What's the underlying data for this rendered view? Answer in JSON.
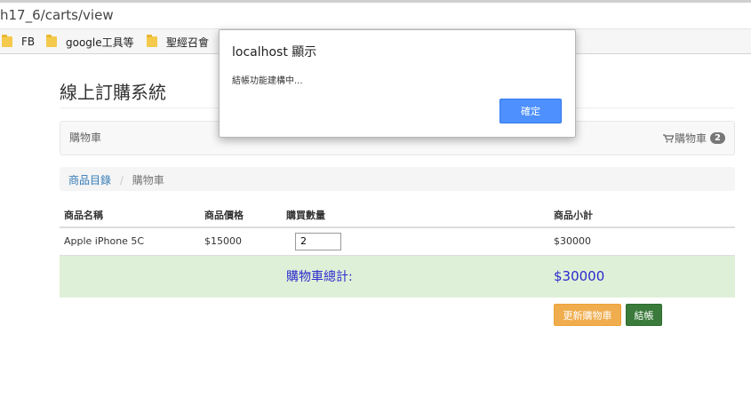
{
  "browser": {
    "url": "h17_6/carts/view",
    "bookmarks": [
      "FB",
      "google工具等",
      "聖經召會"
    ]
  },
  "app": {
    "title": "線上訂購系統"
  },
  "navbar": {
    "brand": "購物車",
    "cart_label": "購物車",
    "cart_count": "2"
  },
  "breadcrumb": {
    "link": "商品目錄",
    "separator": "/",
    "current": "購物車"
  },
  "table": {
    "headers": [
      "商品名稱",
      "商品價格",
      "購買數量",
      "商品小計"
    ],
    "rows": [
      {
        "name": "Apple iPhone 5C",
        "price": "$15000",
        "qty": "2",
        "subtotal": "$30000"
      }
    ],
    "total_label": "購物車總計:",
    "total_value": "$30000"
  },
  "buttons": {
    "update": "更新購物車",
    "checkout": "結帳"
  },
  "dialog": {
    "title": "localhost 顯示",
    "message": "結帳功能建構中...",
    "ok": "確定"
  },
  "colors": {
    "ok_button": "#4d90fe",
    "update_button": "#f0ad4e",
    "checkout_button": "#3a7a3a",
    "total_row": "#dff0d8",
    "total_text": "#2a2acc"
  }
}
